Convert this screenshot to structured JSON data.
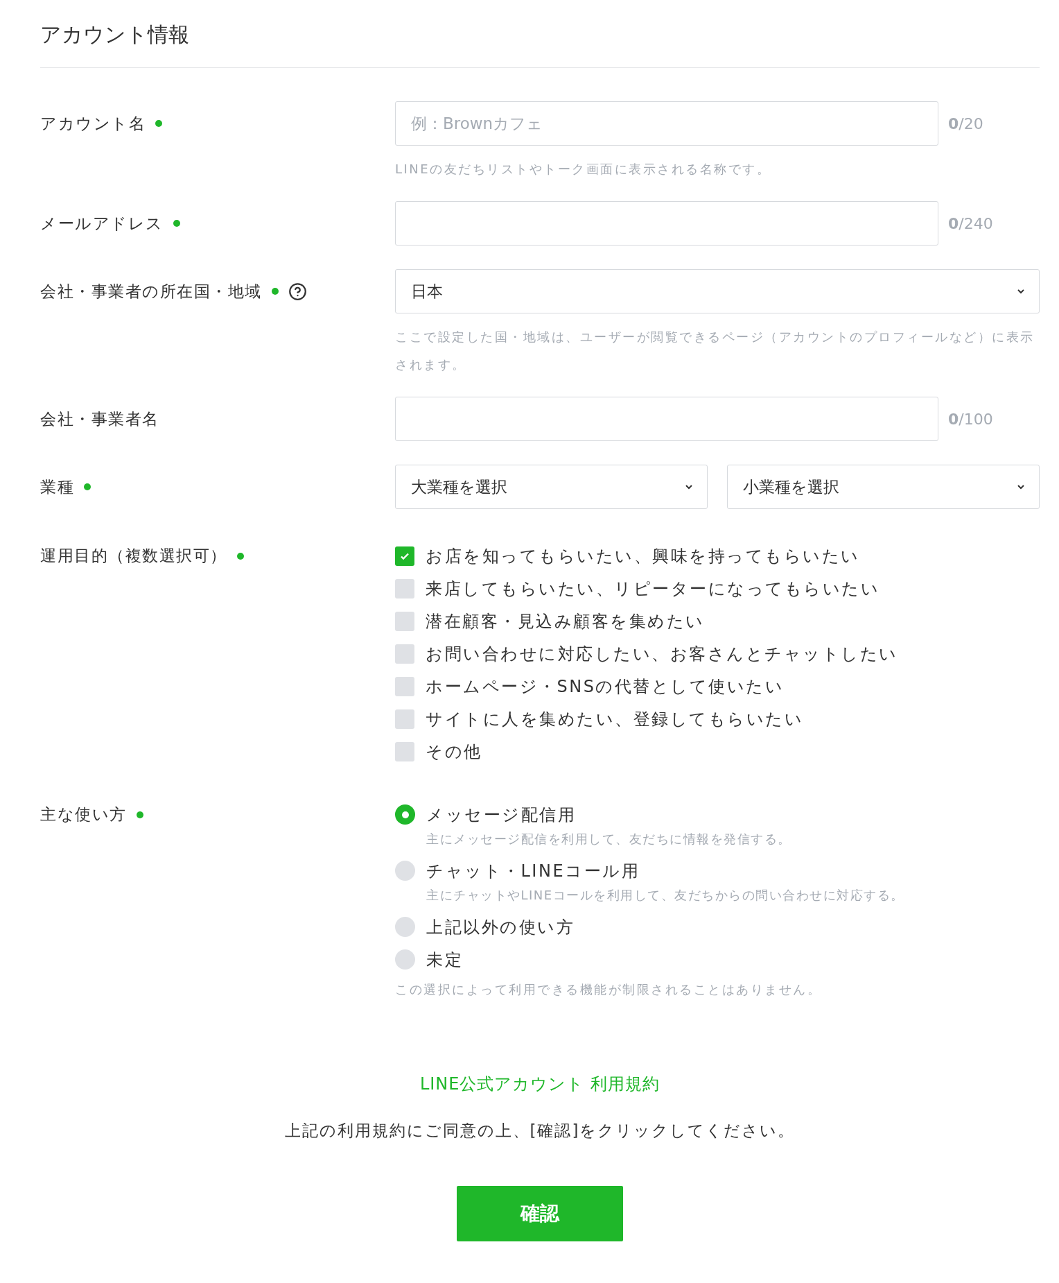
{
  "title": "アカウント情報",
  "fields": [
    {
      "kind": "text",
      "label": "アカウント名",
      "required": true,
      "help": false,
      "placeholder": "例：Brownカフェ",
      "count": "0",
      "limit": "/20",
      "hint": "LINEの友だちリストやトーク画面に表示される名称です。"
    },
    {
      "kind": "text",
      "label": "メールアドレス",
      "required": true,
      "help": false,
      "count": "0",
      "limit": "/240"
    },
    {
      "kind": "select",
      "label": "会社・事業者の所在国・地域",
      "required": true,
      "help": true,
      "value": "日本",
      "hint": "ここで設定した国・地域は、ユーザーが閲覧できるページ（アカウントのプロフィールなど）に表示されます。"
    },
    {
      "kind": "text",
      "label": "会社・事業者名",
      "required": false,
      "help": false,
      "count": "0",
      "limit": "/100"
    },
    {
      "kind": "select_pair",
      "label": "業種",
      "required": true,
      "help": false,
      "selects": [
        "大業種を選択",
        "小業種を選択"
      ]
    },
    {
      "kind": "checkboxes",
      "label": "運用目的（複数選択可）",
      "required": true,
      "help": false,
      "options": [
        {
          "label": "お店を知ってもらいたい、興味を持ってもらいたい",
          "checked": true
        },
        {
          "label": "来店してもらいたい、リピーターになってもらいたい",
          "checked": false
        },
        {
          "label": "潜在顧客・見込み顧客を集めたい",
          "checked": false
        },
        {
          "label": "お問い合わせに対応したい、お客さんとチャットしたい",
          "checked": false
        },
        {
          "label": "ホームページ・SNSの代替として使いたい",
          "checked": false
        },
        {
          "label": "サイトに人を集めたい、登録してもらいたい",
          "checked": false
        },
        {
          "label": "その他",
          "checked": false
        }
      ]
    },
    {
      "kind": "radios",
      "label": "主な使い方",
      "required": true,
      "help": false,
      "options": [
        {
          "label": "メッセージ配信用",
          "selected": true,
          "description": "主にメッセージ配信を利用して、友だちに情報を発信する。"
        },
        {
          "label": "チャット・LINEコール用",
          "selected": false,
          "description": "主にチャットやLINEコールを利用して、友だちからの問い合わせに対応する。"
        },
        {
          "label": "上記以外の使い方",
          "selected": false
        },
        {
          "label": "未定",
          "selected": false
        }
      ],
      "hint": "この選択によって利用できる機能が制限されることはありません。"
    }
  ],
  "terms_link": "LINE公式アカウント 利用規約",
  "agreement": "上記の利用規約にご同意の上、[確認]をクリックしてください。",
  "confirm_button": "確認"
}
